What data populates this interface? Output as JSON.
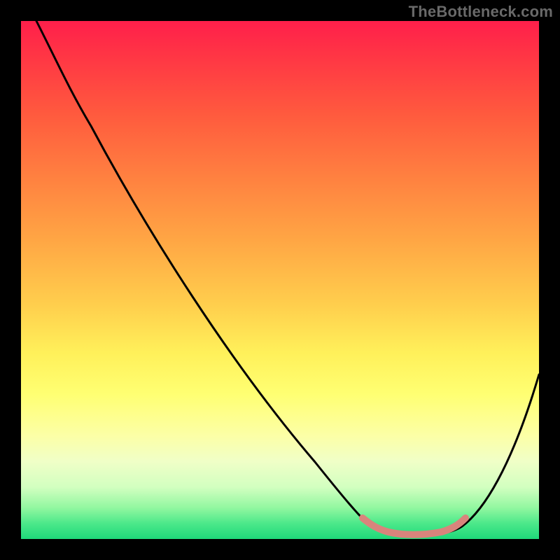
{
  "watermark": "TheBottleneck.com",
  "chart_data": {
    "type": "line",
    "title": "",
    "xlabel": "",
    "ylabel": "",
    "xlim": [
      0,
      100
    ],
    "ylim": [
      0,
      100
    ],
    "grid": false,
    "legend": false,
    "series": [
      {
        "name": "bottleneck-curve",
        "color": "#000000",
        "x": [
          3,
          10,
          20,
          30,
          40,
          50,
          60,
          66,
          70,
          74,
          78,
          82,
          86,
          90,
          94,
          100
        ],
        "values": [
          100,
          90,
          77,
          63,
          49,
          35,
          20,
          9,
          3,
          1,
          0.5,
          0.5,
          1,
          5,
          13,
          32
        ]
      },
      {
        "name": "optimal-flat-region",
        "color": "#d9847c",
        "x": [
          66,
          70,
          74,
          78,
          82,
          86
        ],
        "values": [
          3,
          2,
          1.5,
          1.5,
          2,
          3
        ]
      }
    ],
    "annotations": []
  },
  "colors": {
    "background": "#000000",
    "gradient_top": "#ff1f4b",
    "gradient_bottom": "#1fd97a",
    "curve": "#000000",
    "highlight": "#d9847c",
    "watermark": "#696969"
  }
}
